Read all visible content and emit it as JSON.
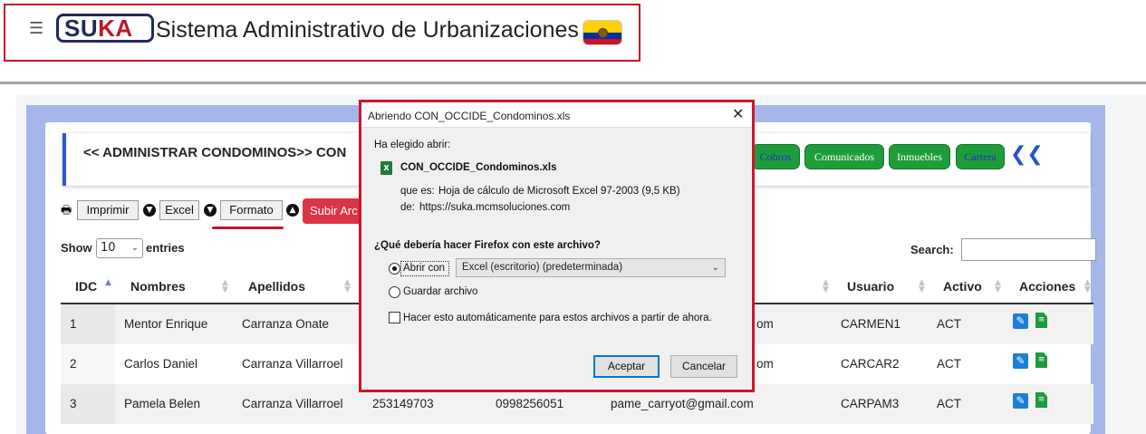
{
  "header": {
    "logo_part1": "SU",
    "logo_part2": "KA",
    "title": "Sistema Administrativo de Urbanizaciones"
  },
  "card": {
    "title": "<< ADMINISTRAR CONDOMINOS>> CON",
    "nav_buttons": [
      "Cobros",
      "Comunicados",
      "Inmuebles",
      "Cartera"
    ]
  },
  "toolbar": {
    "print_label": "Imprimir",
    "excel_label": "Excel",
    "format_label": "Formato",
    "upload_label": "Subir Arc"
  },
  "datatable": {
    "show_label": "Show",
    "entries_value": "10",
    "entries_label": "entries",
    "search_label": "Search:",
    "search_value": "",
    "columns": [
      "IDC",
      "Nombres",
      "Apellidos",
      "Usuario",
      "Activo",
      "Acciones"
    ],
    "rows": [
      {
        "idc": "1",
        "nombres": "Mentor Enrique",
        "apellidos": "Carranza Onate",
        "cedula": "",
        "telefono": "",
        "email": "om",
        "usuario": "CARMEN1",
        "activo": "ACT"
      },
      {
        "idc": "2",
        "nombres": "Carlos Daniel",
        "apellidos": "Carranza Villarroel",
        "cedula": "",
        "telefono": "",
        "email": "om",
        "usuario": "CARCAR2",
        "activo": "ACT"
      },
      {
        "idc": "3",
        "nombres": "Pamela Belen",
        "apellidos": "Carranza Villarroel",
        "cedula": "253149703",
        "telefono": "0998256051",
        "email": "pame_carryot@gmail.com",
        "usuario": "CARPAM3",
        "activo": "ACT"
      }
    ]
  },
  "dialog": {
    "title": "Abriendo CON_OCCIDE_Condominos.xls",
    "chosen_label": "Ha elegido abrir:",
    "file_name": "CON_OCCIDE_Condominos.xls",
    "type_label": "que es:",
    "type_value": "Hoja de cálculo de Microsoft Excel 97-2003 (9,5 KB)",
    "from_label": "de:",
    "from_value": "https://suka.mcmsoluciones.com",
    "question": "¿Qué debería hacer Firefox con este archivo?",
    "open_with_label": "Abrir con",
    "open_with_app": "Excel (escritorio) (predeterminada)",
    "save_label": "Guardar archivo",
    "auto_label": "Hacer esto automáticamente para estos archivos a partir de ahora.",
    "ok_label": "Aceptar",
    "cancel_label": "Cancelar"
  },
  "colors": {
    "accent_red": "#c0172b",
    "nav_green": "#1f9d3a",
    "panel_blue": "#a5b6e8"
  }
}
